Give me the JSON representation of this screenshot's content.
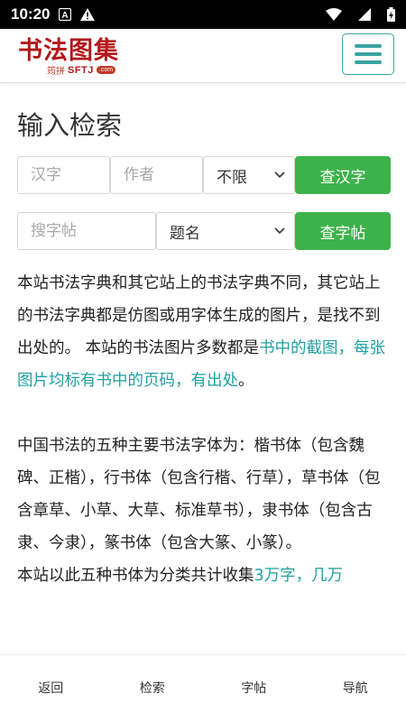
{
  "status_bar": {
    "time": "10:20",
    "icons": [
      "keyboard-a-icon",
      "warning-icon",
      "wifi-icon",
      "signal-icon",
      "battery-icon"
    ]
  },
  "header": {
    "logo_text": "书法图集",
    "logo_pinyin": "筠拼",
    "logo_abbr": "SFTJ",
    "logo_domain": ".com",
    "menu_icon": "hamburger-menu-icon",
    "accent_color": "#3aa3a3",
    "brand_color": "#b3181b"
  },
  "search": {
    "title": "输入检索",
    "char_placeholder": "汉字",
    "author_placeholder": "作者",
    "style_select_value": "不限",
    "char_button": "查汉字",
    "tie_placeholder": "搜字帖",
    "tie_select_value": "题名",
    "tie_button": "查字帖",
    "button_color": "#3db24a"
  },
  "content": {
    "p1_text": "本站书法字典和其它站上的书法字典不同，其它站上的书法字典都是仿图或用字体生成的图片，是找不到出处的。 本站的书法图片多数都是",
    "p1_link": "书中的截图，每张图片均标有书中的页码，有出处",
    "p1_end": "。",
    "p2_text": "中国书法的五种主要书法字体为：楷书体（包含魏碑、正楷），行书体（包含行楷、行草），草书体（包含章草、小草、大草、标准草书），隶书体（包含古隶、今隶），篆书体（包含大篆、小篆）。",
    "p3_text": "本站以此五种书体为分类共计收集",
    "p3_link": "3万字，几万",
    "link_color": "#20a0a0"
  },
  "bottom_nav": {
    "back": "返回",
    "search": "检索",
    "tie": "字帖",
    "nav": "导航"
  }
}
